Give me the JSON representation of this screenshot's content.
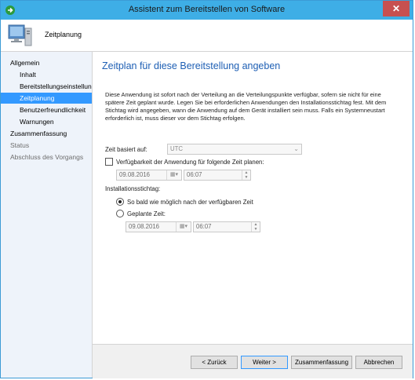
{
  "window": {
    "title": "Assistent zum Bereitstellen von Software",
    "close_glyph": "✕"
  },
  "header": {
    "title": "Zeitplanung"
  },
  "sidebar": {
    "items": [
      {
        "label": "Allgemein"
      },
      {
        "label": "Inhalt"
      },
      {
        "label": "Bereitstellungseinstellungen"
      },
      {
        "label": "Zeitplanung"
      },
      {
        "label": "Benutzerfreundlichkeit"
      },
      {
        "label": "Warnungen"
      },
      {
        "label": "Zusammenfassung"
      },
      {
        "label": "Status"
      },
      {
        "label": "Abschluss des Vorgangs"
      }
    ]
  },
  "main": {
    "heading": "Zeitplan für diese Bereitstellung angeben",
    "description": "Diese Anwendung ist sofort nach der Verteilung an die Verteilungspunkte verfügbar, sofern sie nicht für eine spätere Zeit geplant wurde. Legen Sie bei erforderlichen Anwendungen den Installationsstichtag fest. Mit dem Stichtag wird angegeben, wann die Anwendung auf dem Gerät installiert sein muss. Falls ein Systemneustart erforderlich ist, muss dieser vor dem Stichtag erfolgen.",
    "time_based_on_label": "Zeit basiert auf:",
    "time_based_on_value": "UTC",
    "availability_checkbox_label": "Verfügbarkeit der Anwendung für folgende Zeit planen:",
    "availability_date": "09.08.2016",
    "availability_time": "06:07",
    "install_deadline_label": "Installationsstichtag:",
    "option_asap_label": "So bald wie möglich nach der verfügbaren Zeit",
    "option_scheduled_label": "Geplante Zeit:",
    "deadline_date": "09.08.2016",
    "deadline_time": "06:07"
  },
  "footer": {
    "back_label": "< Zurück",
    "next_label": "Weiter >",
    "summary_label": "Zusammenfassung",
    "cancel_label": "Abbrechen"
  },
  "colors": {
    "titlebar": "#3eaee6",
    "accent": "#3399ff",
    "heading": "#1e5fb4",
    "close": "#c75050"
  }
}
